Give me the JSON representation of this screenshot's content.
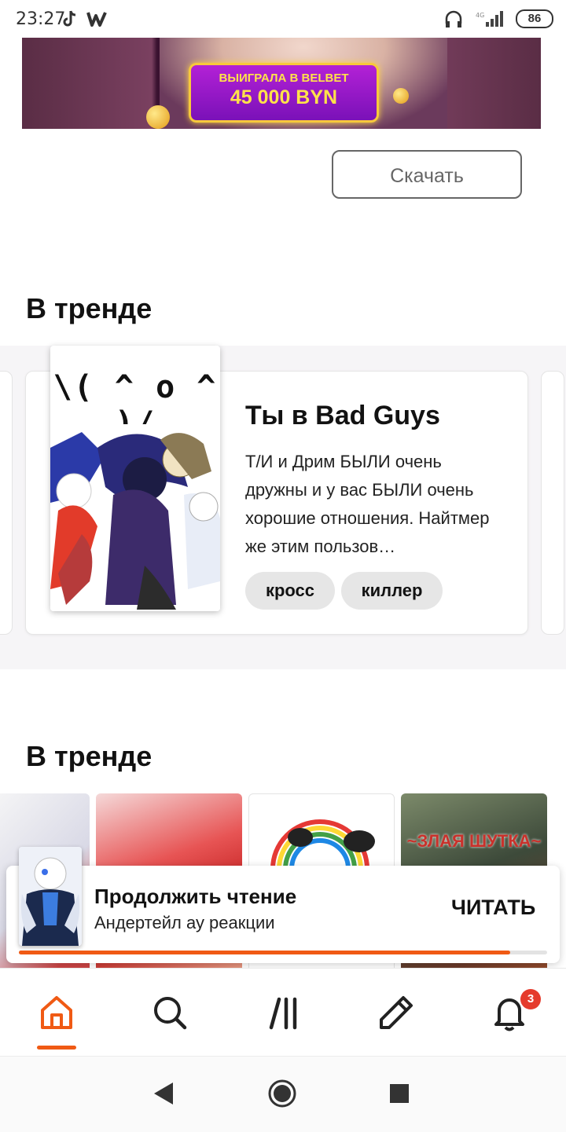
{
  "status_bar": {
    "time": "23:27",
    "battery": "86"
  },
  "ad": {
    "line1": "ВЫИГРАЛА В BELBET",
    "line2": "45 000 BYN",
    "download_label": "Скачать"
  },
  "trending_1": {
    "title": "В тренде",
    "story": {
      "cover_text": "\\( ^ o ^ )/",
      "title": "Ты в Bad Guys",
      "description": "Т/И и Дрим БЫЛИ очень дружны и у вас БЫЛИ очень хорошие отношения. Найтмер же этим пользов…",
      "tags": [
        "кросс",
        "киллер"
      ]
    }
  },
  "trending_2": {
    "title": "В тренде",
    "thumb_text": "~ЗЛАЯ ШУТКА~"
  },
  "continue_reading": {
    "title": "Продолжить чтение",
    "story": "Андертейл ау реакции",
    "action": "ЧИТАТЬ",
    "progress": 0.93
  },
  "bottom_nav": {
    "items": [
      "home-icon",
      "search-icon",
      "library-icon",
      "write-icon",
      "notifications-icon"
    ],
    "active": "home",
    "notification_count": "3"
  },
  "colors": {
    "accent": "#f05a14",
    "badge": "#e53b2c",
    "text": "#121212"
  }
}
